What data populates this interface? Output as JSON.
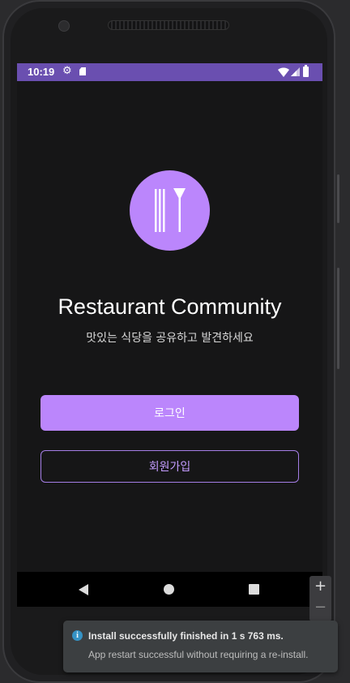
{
  "status_bar": {
    "time": "10:19",
    "icons": [
      "gear-icon",
      "sd-card-icon",
      "wifi-icon",
      "signal-icon",
      "battery-icon"
    ]
  },
  "app": {
    "logo_icon": "utensils-icon",
    "title": "Restaurant Community",
    "subtitle": "맛있는 식당을 공유하고 발견하세요",
    "login_label": "로그인",
    "signup_label": "회원가입",
    "accent_color": "#bb86fc",
    "background_color": "#161617"
  },
  "nav_bar": {
    "icons": [
      "back-icon",
      "home-icon",
      "recents-icon"
    ]
  },
  "emulator": {
    "zoom_in": "+",
    "zoom_out": "−"
  },
  "notification": {
    "title": "Install successfully finished in 1 s 763 ms.",
    "body": "App restart successful without requiring a re-install.",
    "icon": "info-icon",
    "icon_color": "#3592c4"
  }
}
